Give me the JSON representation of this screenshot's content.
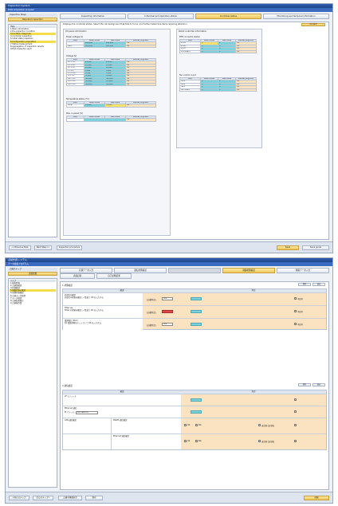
{
  "window1": {
    "title": "Inspection System",
    "subtitle": "Data acquisition program",
    "tabs": [
      "Inspecting information",
      "Individual and operation status",
      "Controller status",
      "Monitoring and temporal information"
    ],
    "active_tab": 2,
    "sidebar_head": "Inspection Steps",
    "sidebar_button": "Required inspection",
    "sidebar_items": [
      "Help",
      "1.Basic information",
      "2.Pre-inspection condition",
      "3.Condition diagnosis",
      "4.Controller inspection",
      "5.Initial state inspection",
      "6.Configuration acquisition",
      "7.Status measurement",
      "8.Aggregation of inspection results",
      "9.Post-inspection work"
    ],
    "selected_items": [
      3,
      6
    ],
    "description": "Displays the controller status. Select the cell background that fails to focus, and further determine items requiring attention.",
    "correct_button": "Correct",
    "left_panel_title": "I/O panel information",
    "right_panel_title": "Robot controller information",
    "headers": [
      "Item",
      "Rated value",
      "Last value",
      "Manual judgment"
    ],
    "power_group": "Power voltage [V]",
    "power_rows": [
      [
        "",
        "220.000",
        "220.000",
        "OK"
      ],
      [
        "Main",
        "220.000",
        "220.000",
        "OK"
      ]
    ],
    "voltage_group": "Voltage [V]",
    "voltage_rows": [
      [
        "24 V DC",
        "24.000",
        "24.020",
        "OK"
      ],
      [
        "15 V DC",
        "15.000",
        "15.000",
        "OK"
      ],
      [
        "12 V DC",
        "12.000",
        "12.000",
        "OK"
      ],
      [
        "5 V DC",
        "5.000",
        "5.000",
        "OK"
      ],
      [
        "3.3 V DC",
        "3.300",
        "3.300",
        "OK"
      ],
      [
        "-5 V DC",
        "-5.000",
        "-5.000",
        "OK"
      ],
      [
        "-12 V DC",
        "-12.000",
        "-12.000",
        "OK"
      ],
      [
        "-15 V DC",
        "-15.000",
        "-15.000",
        "OK"
      ],
      [
        "-24 V DC",
        "-24.000",
        "-24.000",
        "OK"
      ]
    ],
    "temp_group": "Temperature status [°C]",
    "temp_rows": [
      [
        "Temp",
        "45.000",
        "75.000",
        "OK"
      ]
    ],
    "fan_group": "Max. in-panel [%]",
    "fan_rows": [
      [
        "",
        "",
        "",
        "OK"
      ]
    ],
    "rc_group1": "RTD connector status",
    "rc_rows1": [
      [
        "RTD1",
        "0",
        "0",
        "OK"
      ],
      [
        "RTD2",
        "0",
        "0",
        "OK"
      ],
      [
        "RTD3",
        "0",
        "0",
        "OK"
      ],
      [
        "RTD Board",
        "0",
        "0",
        "OK"
      ]
    ],
    "rc_group2": "Fan control count",
    "rc_rows2": [
      [
        "Fan1",
        "0",
        "0",
        "OK"
      ],
      [
        "Fan2",
        "0",
        "0",
        "OK"
      ],
      [
        "Fan3",
        "0",
        "0",
        "OK"
      ],
      [
        "Fan Board",
        "0",
        "0",
        "OK"
      ]
    ],
    "footer_buttons": [
      "<<Previous Step",
      "Next Step>>",
      "Inspection procedure"
    ],
    "footer_right": [
      "Save",
      "Save guide"
    ]
  },
  "window2": {
    "title": "点検支援システム",
    "subtitle": "データ収集プログラム",
    "tabs_row1": [
      "共通データ入力",
      "運転状態確認",
      "",
      "制御状態確認",
      "関係データ入力"
    ],
    "tabs_row2": [
      "点検記録",
      "自己診断結果"
    ],
    "active_tab": 3,
    "sidebar_head": "点検ステップ",
    "sidebar_button": "点検支援",
    "sidebar_items": [
      "ヘルプ",
      "1.基本情報",
      "2.点検前確認",
      "3.状態確認",
      "4.制御状態の確認",
      "5.初期状態確認",
      "6.点検データ取得",
      "7.データ確認",
      "8.点検結果集計",
      "9.点検後作業"
    ],
    "selected_items": [
      4
    ],
    "section1_title": "1.状態確認",
    "section1_buttons": [
      "保存",
      "読込"
    ],
    "section1_headers": [
      "確認",
      "判定"
    ],
    "section1_rows": [
      {
        "title": "外部信号確認",
        "desc": "外部信号状態を確認し一覧表で OK を入力する。",
        "mode": "【自動判定】",
        "value": "OFF",
        "red": false
      },
      {
        "title": "FPGA ver",
        "desc": "FPGA の状態を確認し一覧表で OK を入力する。",
        "mode": "【自動判定】",
        "value": "",
        "red": true
      },
      {
        "title": "電源電圧 (DCV)",
        "desc": "DC 電源状態をチェックして OK を入力する。",
        "mode": "【自動判定】",
        "value": "OFF",
        "red": false
      }
    ],
    "ok_label": "OK",
    "fail_label": "不良有",
    "section2_title": "2.通信確認",
    "section2_buttons": [
      "保存",
      "読込"
    ],
    "section2_headers": [
      "確認",
      "判定"
    ],
    "section2_rows": [
      {
        "title": "I/F モジュール"
      },
      {
        "title": "Ethernet 通信",
        "ip_label": "IP アドレス",
        "ip_value": "192.168.0.10"
      },
      {
        "title": "CAN 通信確認",
        "sub": "RS485 通信確認",
        "opts": [
          "OK",
          "NG",
          "未実施 (該当無)"
        ]
      },
      {
        "title": "",
        "sub": "Ethernet 通信確認",
        "opts": [
          "OK",
          "NG",
          "未実施 (該当無)"
        ]
      }
    ],
    "footer_buttons": [
      "<前のステップ",
      "次のステップ>",
      "点検手順書表示",
      "保存"
    ],
    "footer_right": [
      "印刷"
    ]
  }
}
